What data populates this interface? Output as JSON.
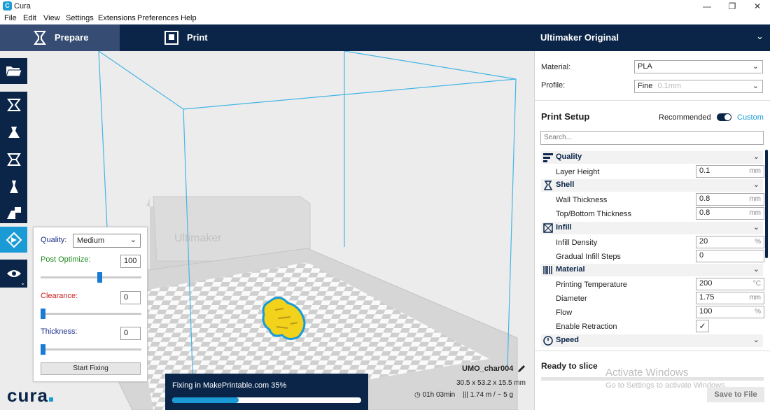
{
  "window": {
    "title": "Cura",
    "controls": [
      "—",
      "❐",
      "✕"
    ]
  },
  "menu": [
    "File",
    "Edit",
    "View",
    "Settings",
    "Extensions",
    "Preferences",
    "Help"
  ],
  "header": {
    "tabs": [
      {
        "label": "Prepare",
        "icon": "prepare-icon"
      },
      {
        "label": "Print",
        "icon": "print-icon"
      }
    ],
    "machine": "Ultimaker Original"
  },
  "viewport": {
    "plate_text": "Ultimaker"
  },
  "makeprintable": {
    "quality_label": "Quality:",
    "quality_value": "Medium",
    "post_optimize_label": "Post Optimize:",
    "post_optimize_value": "100",
    "post_optimize_level": 0.58,
    "clearance_label": "Clearance:",
    "clearance_value": "0",
    "thickness_label": "Thickness:",
    "thickness_value": "0",
    "start_button": "Start Fixing"
  },
  "progress": {
    "text": "Fixing in MakePrintable.com 35%",
    "fraction": 0.35
  },
  "object": {
    "name": "UMO_char004",
    "dims": "30.5 x 53.2 x 15.5 mm",
    "time": "01h 03min",
    "material": "1.74 m / ~ 5 g"
  },
  "panel": {
    "material_label": "Material:",
    "material_value": "PLA",
    "profile_label": "Profile:",
    "profile_value": "Fine",
    "profile_hint": "0.1mm",
    "setup_title": "Print Setup",
    "recommended": "Recommended",
    "custom": "Custom",
    "search_placeholder": "Search...",
    "categories": {
      "quality": "Quality",
      "shell": "Shell",
      "infill": "Infill",
      "material": "Material",
      "speed": "Speed"
    },
    "settings": {
      "layer_height": {
        "label": "Layer Height",
        "value": "0.1",
        "unit": "mm"
      },
      "wall_thickness": {
        "label": "Wall Thickness",
        "value": "0.8",
        "unit": "mm"
      },
      "top_bottom_thickness": {
        "label": "Top/Bottom Thickness",
        "value": "0.8",
        "unit": "mm"
      },
      "infill_density": {
        "label": "Infill Density",
        "value": "20",
        "unit": "%"
      },
      "gradual_infill": {
        "label": "Gradual Infill Steps",
        "value": "0",
        "unit": ""
      },
      "printing_temperature": {
        "label": "Printing Temperature",
        "value": "200",
        "unit": "°C"
      },
      "diameter": {
        "label": "Diameter",
        "value": "1.75",
        "unit": "mm"
      },
      "flow": {
        "label": "Flow",
        "value": "100",
        "unit": "%"
      },
      "enable_retraction": {
        "label": "Enable Retraction",
        "checked": true
      }
    },
    "ready": "Ready to slice",
    "save": "Save to File",
    "activate_title": "Activate Windows",
    "activate_sub": "Go to Settings to activate Windows."
  },
  "brand": "cura",
  "colors": {
    "navy": "#0b2549",
    "accent": "#1a9bd6",
    "model": "#f3d21b"
  }
}
